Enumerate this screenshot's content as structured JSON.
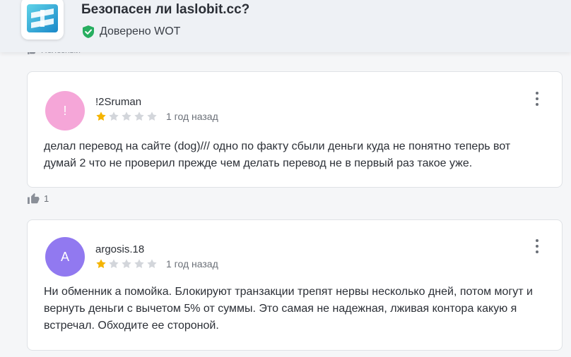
{
  "header": {
    "title": "Безопасен ли laslobit.cc?",
    "trust_label": "Доверено WOT",
    "trust_color": "#27ae60",
    "logo_icon": "wot-logo-icon",
    "behind_text": "Полезный"
  },
  "reviews": [
    {
      "avatar_letter": "!",
      "avatar_color": "#f5a6d8",
      "username": "!2Sruman",
      "rating": 1,
      "max_rating": 5,
      "date": "1 год назад",
      "text": "делал перевод на сайте (dog)/// одно по факту сбыли деньги куда не понятно теперь вот думай 2 что не проверил прежде чем делать перевод не в первый раз такое уже."
    },
    {
      "avatar_letter": "A",
      "avatar_color": "#9179f0",
      "username": "argosis.18",
      "rating": 1,
      "max_rating": 5,
      "date": "1 год назад",
      "text": "Ни обменник а помойка. Блокируют транзакции трепят нервы несколько дней, потом могут и вернуть деньги с вычетом 5% от суммы. Это самая не надежная, лживая контора какую я встречал. Обходите ее стороной."
    }
  ],
  "helpful": {
    "count": "1",
    "icon": "thumbs-up-icon"
  },
  "colors": {
    "star_filled": "#f5b400",
    "star_empty": "#d3d6db"
  }
}
